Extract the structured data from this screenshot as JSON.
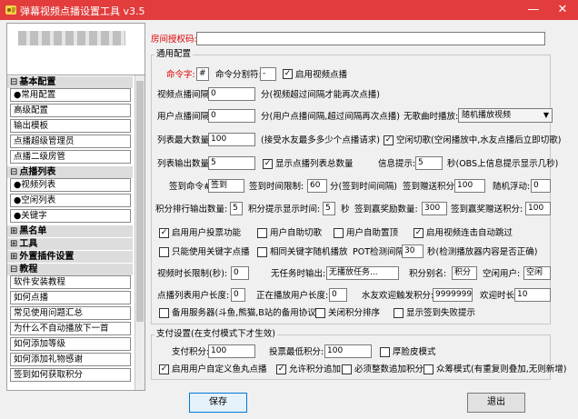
{
  "window": {
    "title": "弹幕视频点播设置工具 v3.5",
    "minimize": "—",
    "close": "✕",
    "accent": "#e23c3c"
  },
  "sidebar": {
    "items": [
      {
        "type": "group",
        "label": "基本配置",
        "expanded": "⊟"
      },
      {
        "type": "item",
        "label": "●常用配置"
      },
      {
        "type": "item",
        "label": "高级配置"
      },
      {
        "type": "item",
        "label": "输出模板"
      },
      {
        "type": "item",
        "label": "点播超级管理员"
      },
      {
        "type": "item",
        "label": "点播二级房管"
      },
      {
        "type": "group",
        "label": "点播列表",
        "expanded": "⊟"
      },
      {
        "type": "item",
        "label": "●视频列表"
      },
      {
        "type": "item",
        "label": "●空闲列表"
      },
      {
        "type": "item",
        "label": "●关键字"
      },
      {
        "type": "group",
        "label": "黑名单",
        "expanded": "⊞"
      },
      {
        "type": "group",
        "label": "工具",
        "expanded": "⊞"
      },
      {
        "type": "group",
        "label": "外置插件设置",
        "expanded": "⊞"
      },
      {
        "type": "group",
        "label": "教程",
        "expanded": "⊟"
      },
      {
        "type": "item",
        "label": "软件安装教程"
      },
      {
        "type": "item",
        "label": "如何点播"
      },
      {
        "type": "item",
        "label": "常见使用问题汇总"
      },
      {
        "type": "item",
        "label": "为什么不自动播放下一首"
      },
      {
        "type": "item",
        "label": "如何添加等级"
      },
      {
        "type": "item",
        "label": "如何添加礼物感谢"
      },
      {
        "type": "item",
        "label": "签到如何获取积分"
      }
    ]
  },
  "auth": {
    "label": "房间授权码:",
    "value": ""
  },
  "general": {
    "title": "通用配置",
    "cmd_label": "命令字:",
    "cmd_value": "#",
    "sep_label": "命令分割符:",
    "sep_value": "-",
    "enable_video_label": "启用视频点播",
    "enable_video_checked": "✓",
    "video_interval_label": "视频点播间隔:",
    "video_interval_value": "0",
    "video_interval_note": "分(视频超过间隔才能再次点播)",
    "user_interval_label": "用户点播间隔:",
    "user_interval_value": "0",
    "user_interval_note": "分(用户点播间隔,超过间隔再次点播)",
    "idle_label": "无歌曲时播放:",
    "idle_value": "随机播放视频",
    "max_list_label": "列表最大数量:",
    "max_list_value": "100",
    "max_list_note": "(接受水友最多多少个点播请求)",
    "idle_switch_label": "空闲切歌(空闲播放中,水友点播后立即切歌)",
    "idle_switch_checked": "✓",
    "list_out_label": "列表输出数量:",
    "list_out_value": "5",
    "show_total_label": "显示点播列表总数量",
    "show_total_checked": "✓",
    "info_tip_label": "信息提示:",
    "info_tip_value": "5",
    "info_tip_note": "秒(OBS上信息提示显示几秒)",
    "signin_cmd_label": "签到命令#",
    "signin_cmd_value": "签到",
    "signin_limit_label": "签到时间限制:",
    "signin_limit_value": "60",
    "signin_limit_note": "分(签到时间间隔)",
    "signin_points_label": "签到赠送积分:",
    "signin_points_value": "100",
    "random_float_label": "随机浮动:",
    "random_float_value": "0",
    "points_out_label": "积分排行输出数量:",
    "points_out_value": "5",
    "points_time_label": "积分提示显示时间:",
    "points_time_value": "5",
    "points_time_unit": "秒",
    "sign_first_label": "签到赢奖励数量:",
    "sign_first_value": "300",
    "sign_first_points_label": "签到赢奖赠送积分:",
    "sign_first_points_value": "100",
    "cb_user_vote": "启用用户投票功能",
    "cb_user_vote_checked": "✓",
    "cb_user_auto": "用户自助切歌",
    "cb_user_auto_checked": "",
    "cb_user_top": "用户自助置顶",
    "cb_user_top_checked": "",
    "cb_auto_skip": "启用视频连击自动跳过",
    "cb_auto_skip_checked": "✓",
    "cb_keyword_only": "只能使用关键字点播",
    "cb_keyword_only_checked": "",
    "cb_same_kw": "相同关键字随机播放",
    "cb_same_kw_checked": "",
    "pot_label": "POT检测间隔:",
    "pot_value": "30",
    "pot_note": "秒(检测播放器内容是否正确)",
    "video_limit_label": "视频时长限制(秒):",
    "video_limit_value": "0",
    "no_task_label": "无任务时输出:",
    "no_task_value": "无播放任务...",
    "points_alias_label": "积分别名:",
    "points_alias_value": "积分",
    "idle_user_label": "空闲用户:",
    "idle_user_value": "空闲",
    "list_user_len_label": "点播列表用户长度:",
    "list_user_len_value": "0",
    "playing_user_len_label": "正在播放用户长度:",
    "playing_user_len_value": "0",
    "welcome_points_label": "水友欢迎触发积分:",
    "welcome_points_value": "9999999",
    "welcome_time_label": "欢迎时长:",
    "welcome_time_value": "10",
    "cb_backup": "备用服务器(斗鱼,熊猫,B站的备用协议)",
    "cb_backup_checked": "",
    "cb_close_rank": "关闭积分排序",
    "cb_close_rank_checked": "",
    "cb_show_fail": "显示签到失败提示",
    "cb_show_fail_checked": ""
  },
  "payment": {
    "title": "支付设置(在支付模式下才生效)",
    "pay_points_label": "支付积分:",
    "pay_points_value": "100",
    "min_vote_label": "投票最低积分:",
    "min_vote_value": "100",
    "cb_thick": "厚脸皮模式",
    "cb_thick_checked": "",
    "cb_custom_fish": "启用用户自定义鱼丸点播",
    "cb_custom_fish_checked": "✓",
    "cb_allow_add": "允许积分追加",
    "cb_allow_add_checked": "✓",
    "cb_must_whole": "必须整数追加积分",
    "cb_must_whole_checked": "",
    "cb_crowd": "众筹模式(有重复则叠加,无则新增)",
    "cb_crowd_checked": ""
  },
  "buttons": {
    "save": "保存",
    "exit": "退出"
  }
}
